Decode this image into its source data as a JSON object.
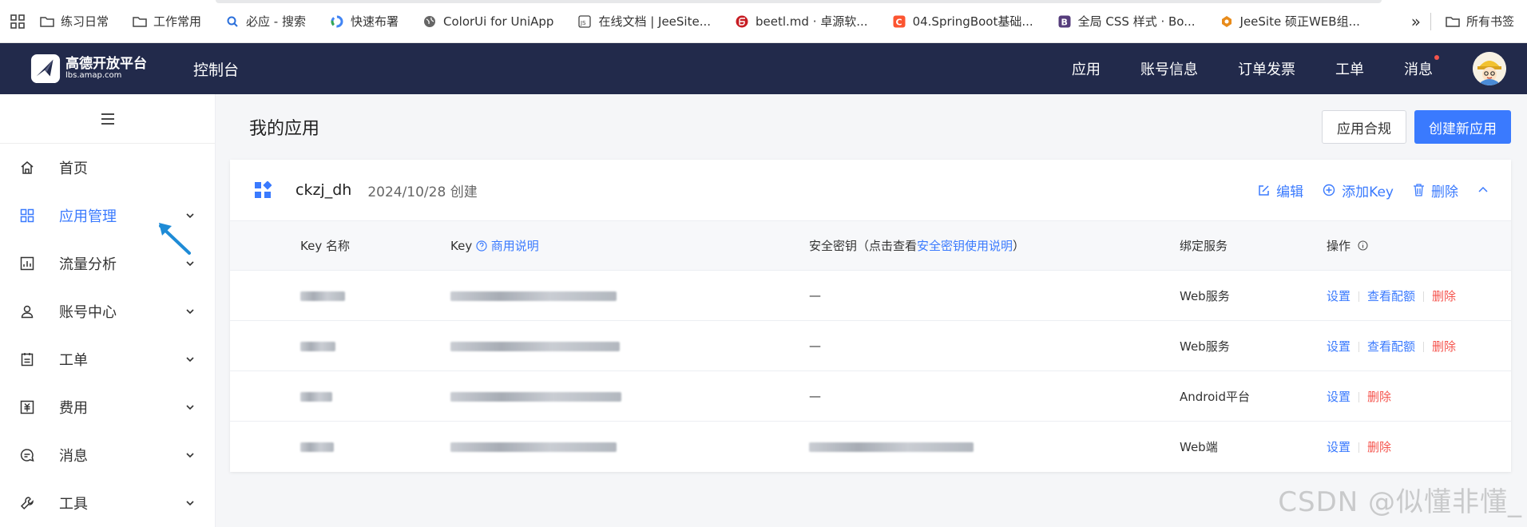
{
  "bookmarks": [
    {
      "label": "练习日常",
      "icon": "folder-icon"
    },
    {
      "label": "工作常用",
      "icon": "folder-icon"
    },
    {
      "label": "必应 - 搜索",
      "icon": "bing-search-icon"
    },
    {
      "label": "快速布署",
      "icon": "google-icon"
    },
    {
      "label": "ColorUi for UniApp",
      "icon": "globe-icon"
    },
    {
      "label": "在线文档 | JeeSite...",
      "icon": "js-doc-icon"
    },
    {
      "label": "beetl.md · 卓源软...",
      "icon": "gitee-icon"
    },
    {
      "label": "04.SpringBoot基础...",
      "icon": "csdn-icon"
    },
    {
      "label": "全局 CSS 样式 · Bo...",
      "icon": "bootstrap-icon"
    },
    {
      "label": "JeeSite 硕正WEB组...",
      "icon": "jeesite-icon"
    }
  ],
  "bookmarks_more": "»",
  "bookmarks_all": "所有书签",
  "brand": {
    "name": "高德开放平台",
    "domain": "lbs.amap.com",
    "console": "控制台"
  },
  "nav": [
    "应用",
    "账号信息",
    "订单发票",
    "工单",
    "消息"
  ],
  "sidebar": [
    {
      "label": "首页",
      "icon": "home-icon",
      "expand": false,
      "active": false
    },
    {
      "label": "应用管理",
      "icon": "grid-icon",
      "expand": true,
      "active": true
    },
    {
      "label": "流量分析",
      "icon": "chart-icon",
      "expand": true,
      "active": false
    },
    {
      "label": "账号中心",
      "icon": "user-icon",
      "expand": true,
      "active": false
    },
    {
      "label": "工单",
      "icon": "ticket-icon",
      "expand": true,
      "active": false
    },
    {
      "label": "费用",
      "icon": "money-icon",
      "expand": true,
      "active": false
    },
    {
      "label": "消息",
      "icon": "message-icon",
      "expand": true,
      "active": false
    },
    {
      "label": "工具",
      "icon": "wrench-icon",
      "expand": true,
      "active": false
    }
  ],
  "page": {
    "title": "我的应用",
    "btn_compliance": "应用合规",
    "btn_create": "创建新应用"
  },
  "app": {
    "name": "ckzj_dh",
    "date": "2024/10/28 创建",
    "edit": "编辑",
    "add_key": "添加Key",
    "delete": "删除"
  },
  "table": {
    "h_keyname": "Key 名称",
    "h_key": "Key",
    "h_key_link": "商用说明",
    "h_secret_prefix": "安全密钥（点击查看",
    "h_secret_link": "安全密钥使用说明",
    "h_secret_suffix": "）",
    "h_service": "绑定服务",
    "h_ops": "操作",
    "rows": [
      {
        "secret": "—",
        "service": "Web服务",
        "ops": [
          "设置",
          "查看配额",
          "删除"
        ]
      },
      {
        "secret": "—",
        "service": "Web服务",
        "ops": [
          "设置",
          "查看配额",
          "删除"
        ]
      },
      {
        "secret": "—",
        "service": "Android平台",
        "ops": [
          "设置",
          "删除"
        ]
      },
      {
        "secret": "",
        "service": "Web端",
        "ops": [
          "设置",
          "删除"
        ]
      }
    ]
  },
  "watermark": "CSDN @似懂非懂_"
}
